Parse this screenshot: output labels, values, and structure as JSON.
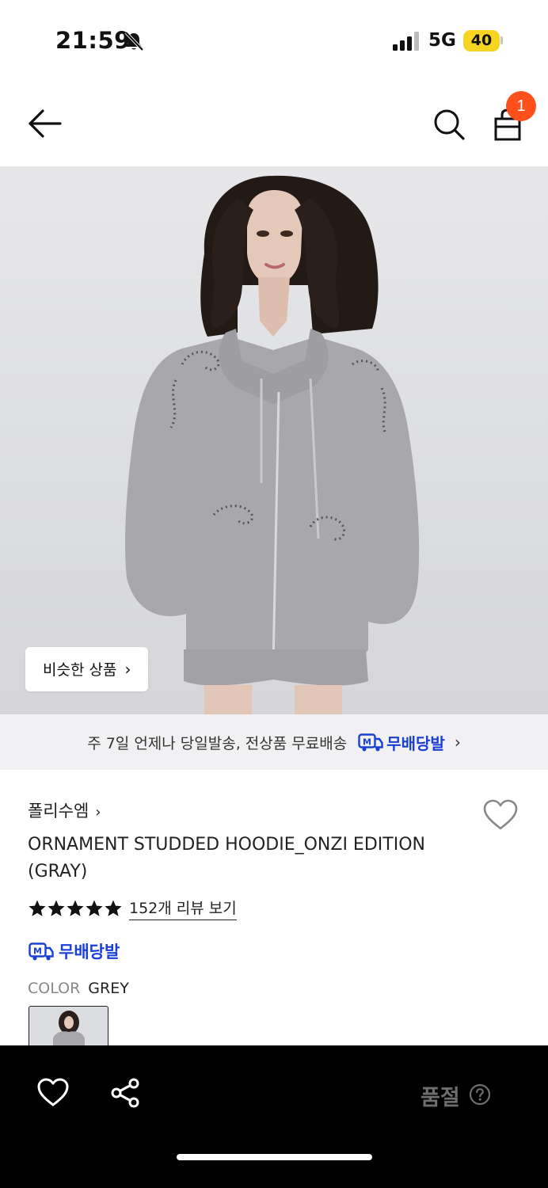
{
  "status_bar": {
    "time": "21:59",
    "network": "5G",
    "battery": "40",
    "icons": [
      "bell-muted-icon",
      "signal-icon"
    ]
  },
  "header": {
    "icons": [
      "back-arrow-icon",
      "search-icon",
      "cart-bag-icon"
    ],
    "cart_count": "1"
  },
  "hero": {
    "similar_button": "비슷한 상품"
  },
  "delivery": {
    "text": "주 7일 언제나 당일발송, 전상품 무료배송",
    "logo_text": "무배당발"
  },
  "product": {
    "brand": "폴리수엠",
    "title": "ORNAMENT STUDDED HOODIE_ONZI EDITION (GRAY)",
    "rating": 5,
    "review_link": "152개 리뷰 보기",
    "badge": "무배당발",
    "color_label": "COLOR",
    "color_value": "GREY"
  },
  "bottom_bar": {
    "status": "품절",
    "icons": [
      "heart-icon",
      "share-icon",
      "help-icon"
    ]
  },
  "colors": {
    "accent_badge": "#ff4f1a",
    "brand_blue": "#1a3fd6",
    "battery": "#f7d322"
  }
}
